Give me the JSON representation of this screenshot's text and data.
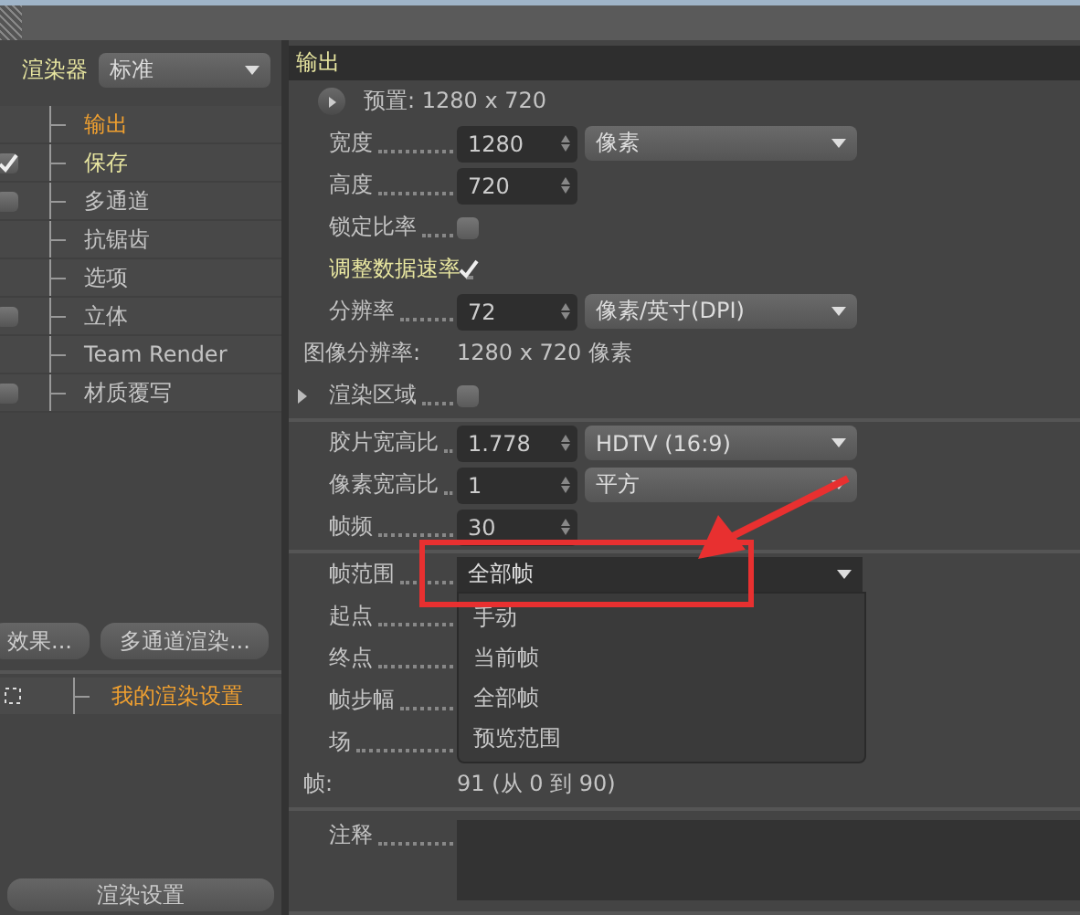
{
  "sidebar": {
    "renderer": {
      "label": "渲染器",
      "value": "标准"
    },
    "items": [
      {
        "label": "输出",
        "kind": "plain",
        "selected": true
      },
      {
        "label": "保存",
        "kind": "checkbox",
        "checked": true,
        "selected": false
      },
      {
        "label": "多通道",
        "kind": "checkbox",
        "checked": false,
        "selected": false
      },
      {
        "label": "抗锯齿",
        "kind": "plain",
        "selected": false
      },
      {
        "label": "选项",
        "kind": "plain",
        "selected": false
      },
      {
        "label": "立体",
        "kind": "checkbox",
        "checked": false,
        "selected": false
      },
      {
        "label": "Team Render",
        "kind": "plain",
        "selected": false
      },
      {
        "label": "材质覆写",
        "kind": "checkbox",
        "checked": false,
        "selected": false
      }
    ],
    "buttons": [
      "效果...",
      "多通道渲染..."
    ],
    "settings": [
      {
        "label": "我的渲染设置",
        "selected": true
      }
    ],
    "bottom_button": "渲染设置"
  },
  "panel": {
    "title": "输出",
    "sections": [
      {
        "rows": [
          {
            "kind": "preset",
            "label": "预置: 1280 x 720"
          },
          {
            "kind": "spin",
            "label": "宽度",
            "value": "1280",
            "dropdown": "像素"
          },
          {
            "kind": "spin",
            "label": "高度",
            "value": "720"
          },
          {
            "kind": "checkbox",
            "label": "锁定比率",
            "checked": false,
            "highlighted": false
          },
          {
            "kind": "checkbox",
            "label": "调整数据速率",
            "checked": true,
            "highlighted": true
          },
          {
            "kind": "spin",
            "label": "分辨率",
            "value": "72",
            "dropdown": "像素/英寸(DPI)"
          },
          {
            "kind": "info",
            "label": "图像分辨率:",
            "value": "1280 x 720 像素"
          },
          {
            "kind": "expand",
            "label": "渲染区域",
            "checked": false,
            "expanded": false
          }
        ]
      },
      {
        "rows": [
          {
            "kind": "spin",
            "label": "胶片宽高比",
            "value": "1.778",
            "dropdown": "HDTV (16:9)"
          },
          {
            "kind": "spin",
            "label": "像素宽高比",
            "value": "1",
            "dropdown": "平方"
          },
          {
            "kind": "spin",
            "label": "帧频",
            "value": "30"
          }
        ]
      },
      {
        "rows": [
          {
            "kind": "select",
            "label": "帧范围",
            "value": "全部帧",
            "open": true,
            "options": [
              {
                "label": "手动"
              },
              {
                "label": "当前帧"
              },
              {
                "label": "全部帧"
              },
              {
                "label": "预览范围"
              }
            ]
          },
          {
            "kind": "label",
            "label": "起点"
          },
          {
            "kind": "label",
            "label": "终点"
          },
          {
            "kind": "label",
            "label": "帧步幅"
          },
          {
            "kind": "label",
            "label": "场"
          },
          {
            "kind": "info",
            "label": "帧:",
            "value": "91 (从 0 到 90)"
          }
        ]
      },
      {
        "rows": [
          {
            "kind": "textarea",
            "label": "注释"
          }
        ]
      }
    ]
  }
}
